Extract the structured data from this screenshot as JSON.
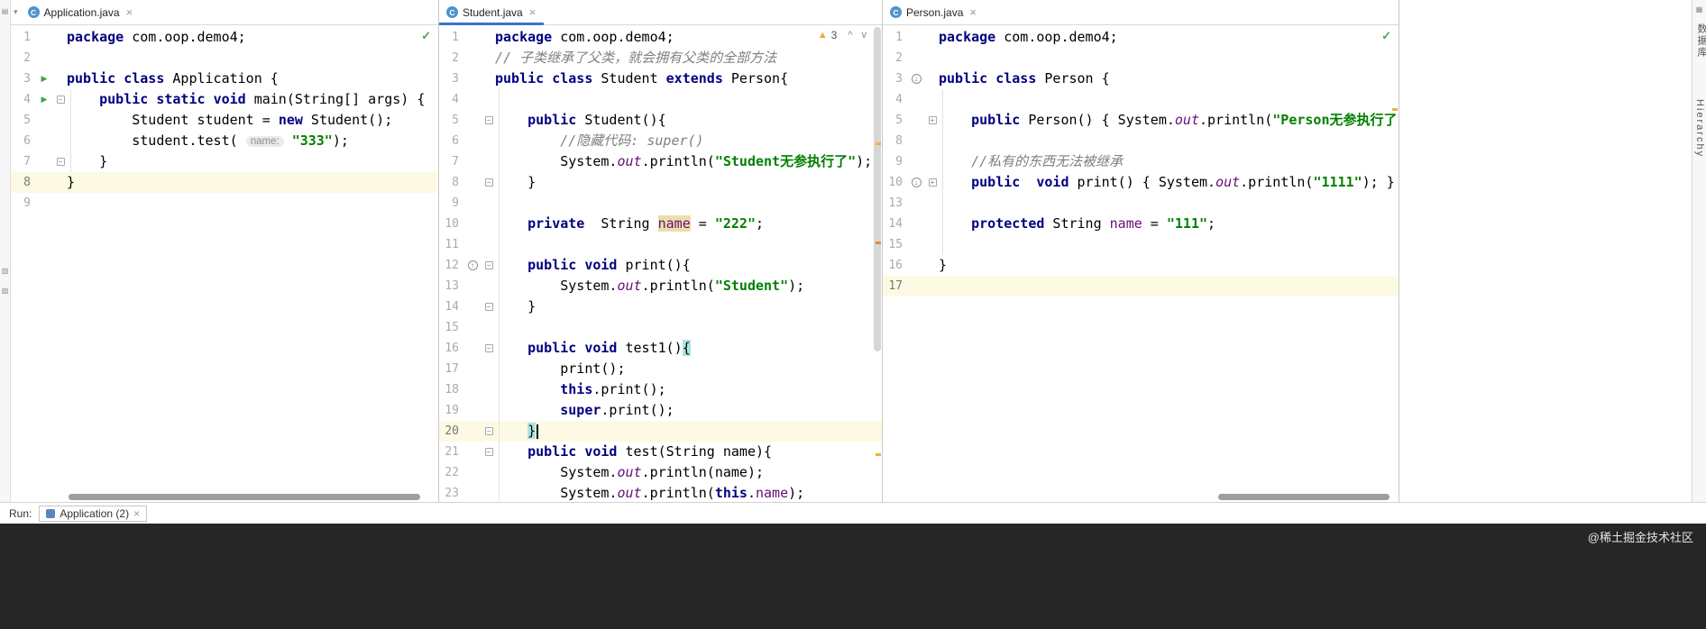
{
  "colors": {
    "accent": "#3874CB",
    "warning": "#F0A732",
    "success": "#4DA356",
    "keyword": "#000080",
    "string": "#008000",
    "comment": "#808080",
    "field": "#660E7A",
    "caret_line": "#FCFAE3",
    "brace_match": "#ACE4E1",
    "field_highlight": "#EBDFA9",
    "dark_band": "#262626"
  },
  "right_toolbar": {
    "labels": [
      "数据库",
      "Hierarchy"
    ]
  },
  "run_bar": {
    "label": "Run:",
    "tab": "Application (2)"
  },
  "watermark": "@稀土掘金技术社区",
  "panes": [
    {
      "file": "Application.java",
      "inspection": "ok",
      "lines": [
        {
          "n": 1,
          "t": [
            [
              "k",
              "package"
            ],
            [
              "p",
              " com.oop.demo4;"
            ]
          ]
        },
        {
          "n": 2,
          "t": []
        },
        {
          "n": 3,
          "g": "run",
          "t": [
            [
              "k",
              "public class"
            ],
            [
              "p",
              " Application {"
            ]
          ]
        },
        {
          "n": 4,
          "g": "run",
          "f": "open",
          "t": [
            [
              "p",
              "    "
            ],
            [
              "k",
              "public static"
            ],
            [
              "p",
              " "
            ],
            [
              "k",
              "void"
            ],
            [
              "p",
              " main(String[] args) {"
            ]
          ]
        },
        {
          "n": 5,
          "t": [
            [
              "p",
              "        Student student = "
            ],
            [
              "k",
              "new"
            ],
            [
              "p",
              " Student();"
            ]
          ]
        },
        {
          "n": 6,
          "t": [
            [
              "p",
              "        student.test( "
            ],
            [
              "h",
              "name:"
            ],
            [
              "p",
              " "
            ],
            [
              "s",
              "\"333\""
            ],
            [
              "p",
              ");"
            ]
          ]
        },
        {
          "n": 7,
          "f": "end",
          "t": [
            [
              "p",
              "    }"
            ]
          ]
        },
        {
          "n": 8,
          "hl": true,
          "t": [
            [
              "p",
              "}"
            ]
          ]
        },
        {
          "n": 9,
          "t": []
        }
      ]
    },
    {
      "file": "Student.java",
      "inspection": "warnings",
      "warnings_count": "3",
      "lines": [
        {
          "n": 1,
          "t": [
            [
              "k",
              "package"
            ],
            [
              "p",
              " com.oop.demo4;"
            ]
          ]
        },
        {
          "n": 2,
          "t": [
            [
              "c",
              "// 子类继承了父类，就会拥有父类的全部方法"
            ]
          ]
        },
        {
          "n": 3,
          "t": [
            [
              "k",
              "public class"
            ],
            [
              "p",
              " Student "
            ],
            [
              "k",
              "extends"
            ],
            [
              "p",
              " Person{"
            ]
          ]
        },
        {
          "n": 4,
          "t": []
        },
        {
          "n": 5,
          "f": "open",
          "t": [
            [
              "p",
              "    "
            ],
            [
              "k",
              "public"
            ],
            [
              "p",
              " Student(){"
            ]
          ]
        },
        {
          "n": 6,
          "t": [
            [
              "c",
              "        //隐藏代码: super()"
            ]
          ]
        },
        {
          "n": 7,
          "t": [
            [
              "p",
              "        System."
            ],
            [
              "sf",
              "out"
            ],
            [
              "p",
              ".println("
            ],
            [
              "s",
              "\"Student无参执行了\""
            ],
            [
              "p",
              ");"
            ]
          ]
        },
        {
          "n": 8,
          "f": "end",
          "t": [
            [
              "p",
              "    }"
            ]
          ]
        },
        {
          "n": 9,
          "t": []
        },
        {
          "n": 10,
          "t": [
            [
              "p",
              "    "
            ],
            [
              "k",
              "private"
            ],
            [
              "p",
              "  String "
            ],
            [
              "fh",
              "name"
            ],
            [
              "p",
              " = "
            ],
            [
              "s",
              "\"222\""
            ],
            [
              "p",
              ";"
            ]
          ]
        },
        {
          "n": 11,
          "t": []
        },
        {
          "n": 12,
          "g": "ovr-up",
          "f": "open",
          "t": [
            [
              "p",
              "    "
            ],
            [
              "k",
              "public"
            ],
            [
              "p",
              " "
            ],
            [
              "k",
              "void"
            ],
            [
              "p",
              " print(){"
            ]
          ]
        },
        {
          "n": 13,
          "t": [
            [
              "p",
              "        System."
            ],
            [
              "sf",
              "out"
            ],
            [
              "p",
              ".println("
            ],
            [
              "s",
              "\"Student\""
            ],
            [
              "p",
              ");"
            ]
          ]
        },
        {
          "n": 14,
          "f": "end",
          "t": [
            [
              "p",
              "    }"
            ]
          ]
        },
        {
          "n": 15,
          "t": []
        },
        {
          "n": 16,
          "f": "open",
          "t": [
            [
              "p",
              "    "
            ],
            [
              "k",
              "public"
            ],
            [
              "p",
              " "
            ],
            [
              "k",
              "void"
            ],
            [
              "p",
              " test1()"
            ],
            [
              "bm",
              "{"
            ]
          ]
        },
        {
          "n": 17,
          "t": [
            [
              "p",
              "        print();"
            ]
          ]
        },
        {
          "n": 18,
          "t": [
            [
              "p",
              "        "
            ],
            [
              "k",
              "this"
            ],
            [
              "p",
              ".print();"
            ]
          ]
        },
        {
          "n": 19,
          "t": [
            [
              "p",
              "        "
            ],
            [
              "k",
              "super"
            ],
            [
              "p",
              ".print();"
            ]
          ]
        },
        {
          "n": 20,
          "hl": true,
          "f": "end",
          "t": [
            [
              "p",
              "    "
            ],
            [
              "bm",
              "}"
            ],
            [
              "cr",
              ""
            ]
          ]
        },
        {
          "n": 21,
          "f": "open",
          "t": [
            [
              "p",
              "    "
            ],
            [
              "k",
              "public"
            ],
            [
              "p",
              " "
            ],
            [
              "k",
              "void"
            ],
            [
              "p",
              " test(String name){"
            ]
          ]
        },
        {
          "n": 22,
          "t": [
            [
              "p",
              "        System."
            ],
            [
              "sf",
              "out"
            ],
            [
              "p",
              ".println(name);"
            ]
          ]
        },
        {
          "n": 23,
          "t": [
            [
              "p",
              "        System."
            ],
            [
              "sf",
              "out"
            ],
            [
              "p",
              ".println("
            ],
            [
              "k",
              "this"
            ],
            [
              "p",
              "."
            ],
            [
              "fd",
              "name"
            ],
            [
              "p",
              ");"
            ]
          ]
        }
      ]
    },
    {
      "file": "Person.java",
      "inspection": "ok",
      "lines": [
        {
          "n": 1,
          "t": [
            [
              "k",
              "package"
            ],
            [
              "p",
              " com.oop.demo4;"
            ]
          ]
        },
        {
          "n": 2,
          "t": []
        },
        {
          "n": 3,
          "g": "ovr-down",
          "t": [
            [
              "k",
              "public class"
            ],
            [
              "p",
              " Person {"
            ]
          ]
        },
        {
          "n": 4,
          "t": []
        },
        {
          "n": 5,
          "f": "closed",
          "t": [
            [
              "p",
              "    "
            ],
            [
              "k",
              "public"
            ],
            [
              "p",
              " Person() { System."
            ],
            [
              "sf",
              "out"
            ],
            [
              "p",
              ".println("
            ],
            [
              "s",
              "\"Person无参执行了\""
            ],
            [
              "p",
              "); }"
            ]
          ]
        },
        {
          "n": 8,
          "t": []
        },
        {
          "n": 9,
          "t": [
            [
              "c",
              "    //私有的东西无法被继承"
            ]
          ]
        },
        {
          "n": 10,
          "g": "ovr-down",
          "f": "closed",
          "t": [
            [
              "p",
              "    "
            ],
            [
              "k",
              "public"
            ],
            [
              "p",
              "  "
            ],
            [
              "k",
              "void"
            ],
            [
              "p",
              " print() { System."
            ],
            [
              "sf",
              "out"
            ],
            [
              "p",
              ".println("
            ],
            [
              "s",
              "\"1111\""
            ],
            [
              "p",
              "); }"
            ]
          ]
        },
        {
          "n": 13,
          "t": []
        },
        {
          "n": 14,
          "t": [
            [
              "p",
              "    "
            ],
            [
              "k",
              "protected"
            ],
            [
              "p",
              " String "
            ],
            [
              "fd",
              "name"
            ],
            [
              "p",
              " = "
            ],
            [
              "s",
              "\"111\""
            ],
            [
              "p",
              ";"
            ]
          ]
        },
        {
          "n": 15,
          "t": []
        },
        {
          "n": 16,
          "t": [
            [
              "p",
              "}"
            ]
          ]
        },
        {
          "n": 17,
          "hl": true,
          "t": []
        }
      ]
    }
  ]
}
